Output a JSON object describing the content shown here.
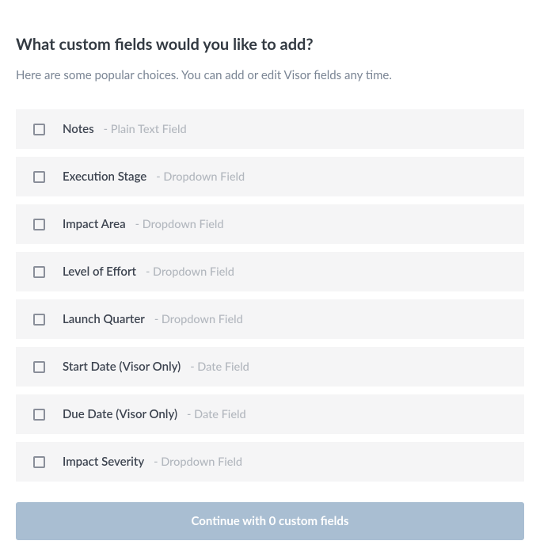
{
  "heading": "What custom fields would you like to add?",
  "subtitle": "Here are some popular choices. You can add or edit Visor fields any time.",
  "fields": [
    {
      "label": "Notes",
      "type": "- Plain Text Field"
    },
    {
      "label": "Execution Stage",
      "type": "- Dropdown Field"
    },
    {
      "label": "Impact Area",
      "type": "- Dropdown Field"
    },
    {
      "label": "Level of Effort",
      "type": "- Dropdown Field"
    },
    {
      "label": "Launch Quarter",
      "type": "- Dropdown Field"
    },
    {
      "label": "Start Date (Visor Only)",
      "type": "- Date Field"
    },
    {
      "label": "Due Date (Visor Only)",
      "type": "- Date Field"
    },
    {
      "label": "Impact Severity",
      "type": "- Dropdown Field"
    }
  ],
  "continue_label": "Continue with 0 custom fields"
}
